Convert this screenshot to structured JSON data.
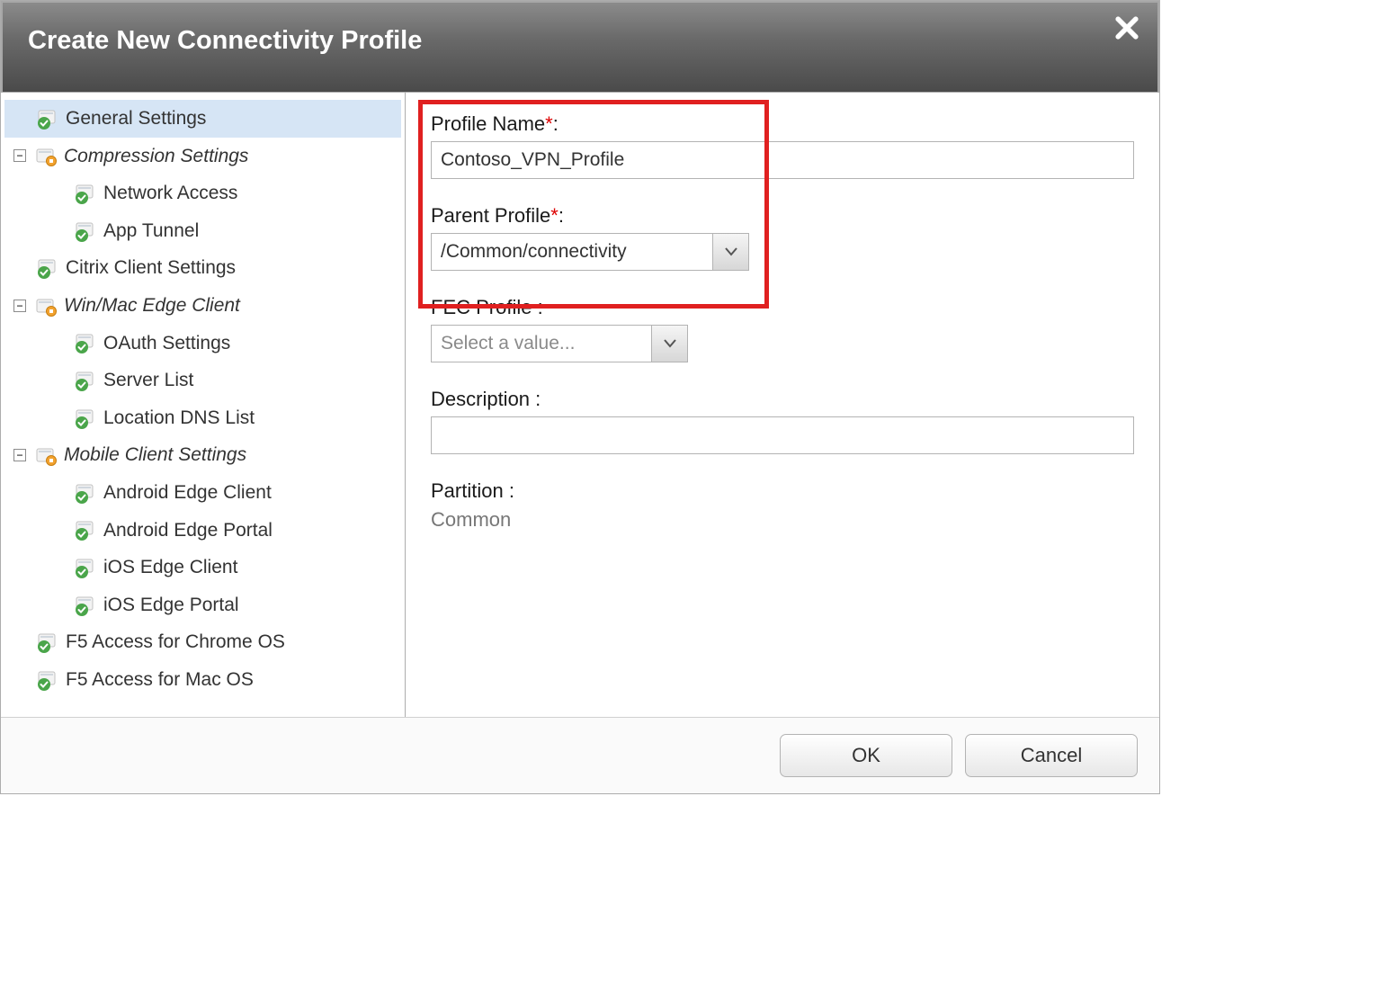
{
  "dialog": {
    "title": "Create New Connectivity Profile"
  },
  "sidebar": {
    "tree": {
      "general_settings": "General Settings",
      "compression": {
        "label": "Compression Settings",
        "children": {
          "network_access": "Network Access",
          "app_tunnel": "App Tunnel"
        }
      },
      "citrix": "Citrix Client Settings",
      "winmac": {
        "label": "Win/Mac Edge Client",
        "children": {
          "oauth": "OAuth Settings",
          "server_list": "Server List",
          "location_dns": "Location DNS List"
        }
      },
      "mobile": {
        "label": "Mobile Client Settings",
        "children": {
          "android_client": "Android Edge Client",
          "android_portal": "Android Edge Portal",
          "ios_client": "iOS Edge Client",
          "ios_portal": "iOS Edge Portal"
        }
      },
      "chrome": "F5 Access for Chrome OS",
      "macos": "F5 Access for Mac OS"
    }
  },
  "form": {
    "profile_name": {
      "label": "Profile Name",
      "value": "Contoso_VPN_Profile",
      "required": true
    },
    "parent_profile": {
      "label": "Parent Profile",
      "value": "/Common/connectivity",
      "required": true
    },
    "fec_profile": {
      "label": "FEC Profile",
      "placeholder": "Select a value..."
    },
    "description": {
      "label": "Description",
      "value": ""
    },
    "partition": {
      "label": "Partition",
      "value": "Common"
    }
  },
  "buttons": {
    "ok": "OK",
    "cancel": "Cancel"
  },
  "glyphs": {
    "collapse": "−",
    "colon": " :"
  }
}
